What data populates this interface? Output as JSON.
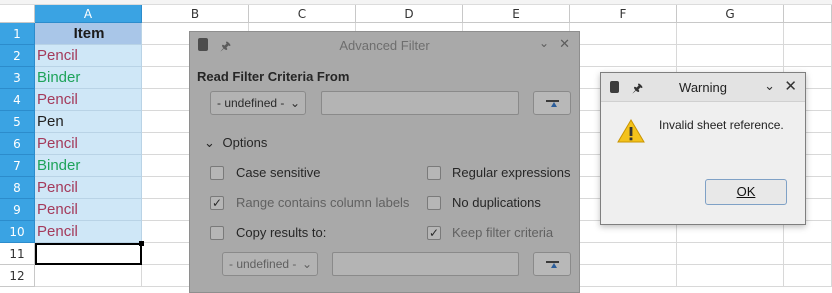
{
  "spreadsheet": {
    "columns": [
      "A",
      "B",
      "C",
      "D",
      "E",
      "F",
      "G"
    ],
    "rows": [
      "1",
      "2",
      "3",
      "4",
      "5",
      "6",
      "7",
      "8",
      "9",
      "10",
      "11",
      "12"
    ],
    "column_a": [
      "Item",
      "Pencil",
      "Binder",
      "Pencil",
      "Pen",
      "Pencil",
      "Binder",
      "Pencil",
      "Pencil",
      "Pencil",
      "",
      ""
    ],
    "colors": {
      "pencil": "#a43a5b",
      "binder": "#1ea35a",
      "pen": "#222222",
      "selection_header": "#3aa3e3",
      "selection_cell": "#cfe7f7"
    }
  },
  "advanced_filter": {
    "title": "Advanced Filter",
    "read_criteria_label": "Read Filter Criteria From",
    "criteria_combo": "- undefined -",
    "criteria_field": "",
    "options_label": "Options",
    "checkboxes": [
      {
        "label": "Case sensitive",
        "checked": false,
        "enabled": true
      },
      {
        "label": "Regular expressions",
        "checked": false,
        "enabled": true
      },
      {
        "label": "Range contains column labels",
        "checked": true,
        "enabled": false
      },
      {
        "label": "No duplications",
        "checked": false,
        "enabled": true
      },
      {
        "label": "Copy results to:",
        "checked": false,
        "enabled": true
      },
      {
        "label": "Keep filter criteria",
        "checked": true,
        "enabled": false
      }
    ],
    "copy_combo": "- undefined -",
    "copy_field": ""
  },
  "warning_dialog": {
    "title": "Warning",
    "message": "Invalid sheet reference.",
    "ok_label": "OK",
    "icon": "warning-triangle-icon"
  }
}
